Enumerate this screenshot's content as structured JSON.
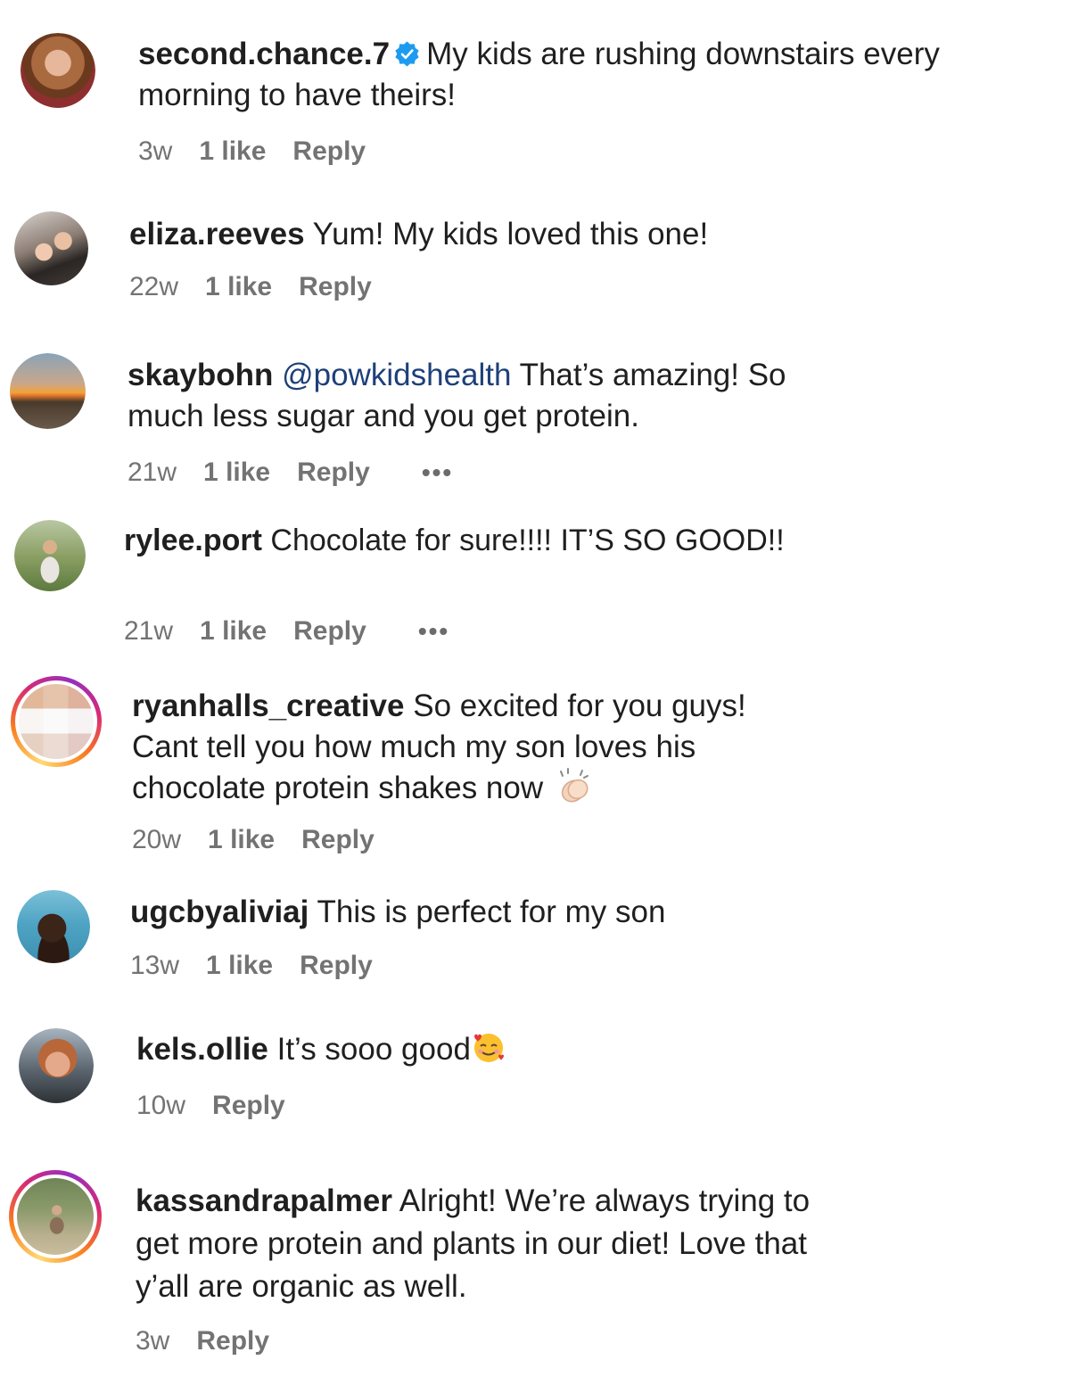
{
  "comments": [
    {
      "username": "second.chance.7",
      "verified": true,
      "mention": "",
      "text": "My kids are rushing downstairs every morning to have theirs!",
      "time": "3w",
      "likes": "1 like",
      "reply": "Reply",
      "avatar": "woman-portrait-avatar"
    },
    {
      "username": "eliza.reeves",
      "verified": false,
      "mention": "",
      "text": "Yum! My kids loved this one!",
      "time": "22w",
      "likes": "1 like",
      "reply": "Reply",
      "avatar": "family-selfie-avatar"
    },
    {
      "username": "skaybohn",
      "verified": false,
      "mention": "@powkidshealth",
      "text": "That’s amazing! So much less sugar and you get protein.",
      "time": "21w",
      "likes": "1 like",
      "reply": "Reply",
      "more": "•••",
      "avatar": "sunset-beach-avatar"
    },
    {
      "username": "rylee.port",
      "verified": false,
      "mention": "",
      "text": "Chocolate for sure!!!! IT’S SO GOOD!!",
      "time": "21w",
      "likes": "1 like",
      "reply": "Reply",
      "more": "•••",
      "avatar": "woman-sitting-grass-avatar"
    },
    {
      "username": "ryanhalls_creative",
      "verified": false,
      "mention": "",
      "text": "So excited for you guys! Cant tell you how much my son loves his chocolate protein shakes now",
      "emoji": "clapping-hands-emoji",
      "time": "20w",
      "likes": "1 like",
      "reply": "Reply",
      "avatar": "collage-avatar"
    },
    {
      "username": "ugcbyaliviaj",
      "verified": false,
      "mention": "",
      "text": "This is perfect for my son",
      "time": "13w",
      "likes": "1 like",
      "reply": "Reply",
      "avatar": "woman-pool-avatar"
    },
    {
      "username": "kels.ollie",
      "verified": false,
      "mention": "",
      "text": "It’s sooo good",
      "emoji": "smiling-face-hearts-emoji",
      "time": "10w",
      "likes": "",
      "reply": "Reply",
      "avatar": "woman-car-selfie-avatar"
    },
    {
      "username": "kassandrapalmer",
      "verified": false,
      "mention": "",
      "text": "Alright! We’re always trying to get more protein and plants in our diet! Love that y’all are organic as well.",
      "time": "3w",
      "likes": "",
      "reply": "Reply",
      "avatar": "woman-field-avatar"
    }
  ],
  "colors": {
    "text": "#1f1f1f",
    "meta": "#737373",
    "mention": "#1e3f7a",
    "verified": "#1d9bf0"
  }
}
